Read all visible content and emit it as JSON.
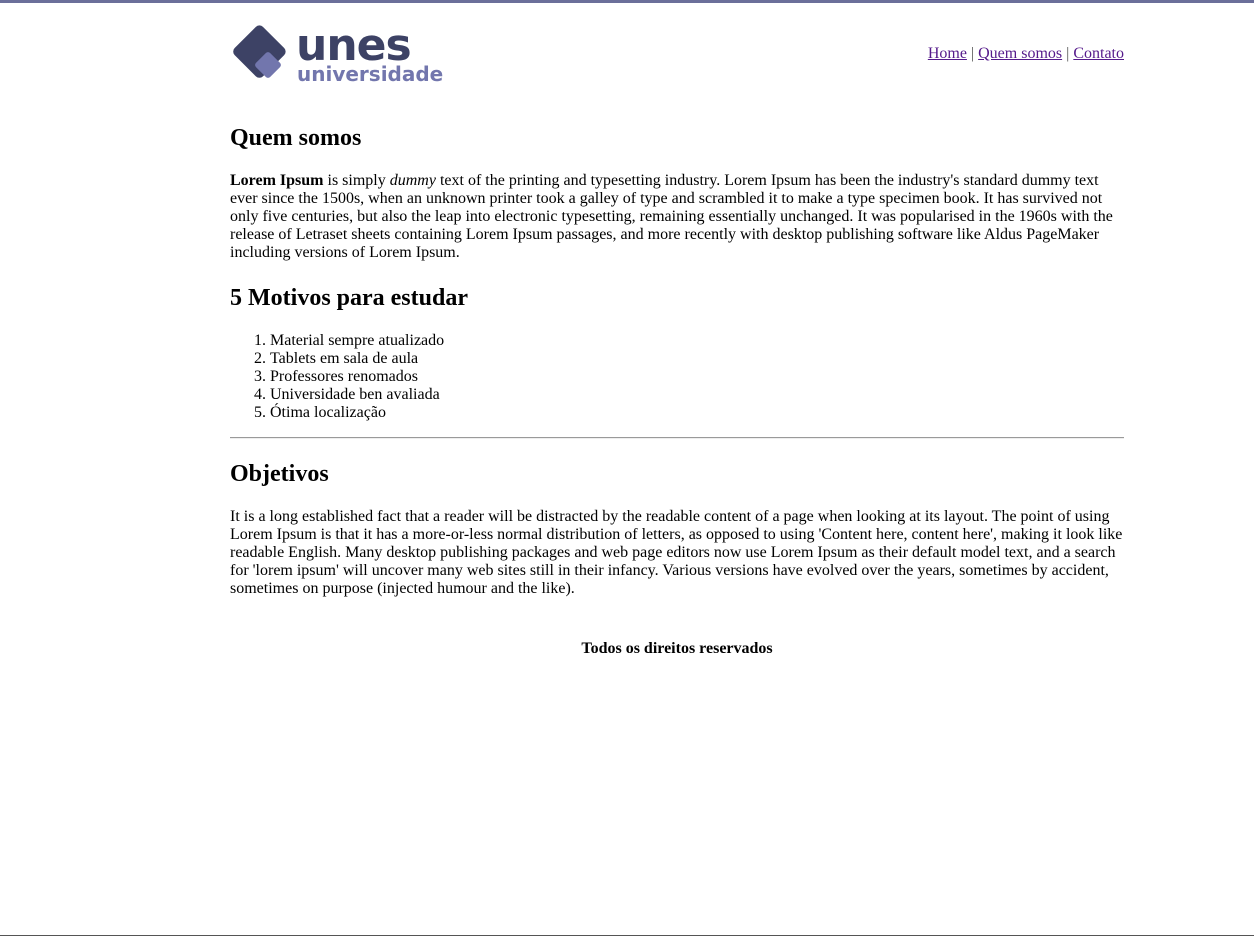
{
  "header": {
    "logo": {
      "brand": "unes",
      "subtitle": "universidade",
      "colors": {
        "dark": "#3d4265",
        "light": "#7276ad"
      }
    },
    "nav": [
      {
        "label": "Home"
      },
      {
        "label": "Quem somos"
      },
      {
        "label": "Contato"
      }
    ],
    "separator": "|"
  },
  "quem_somos": {
    "title": "Quem somos",
    "lead_bold": "Lorem Ipsum",
    "text_1": " is simply ",
    "emphasis": "dummy",
    "text_2": " text of the printing and typesetting industry. Lorem Ipsum has been the industry's standard dummy text ever since the 1500s, when an unknown printer took a galley of type and scrambled it to make a type specimen book. It has survived not only five centuries, but also the leap into electronic typesetting, remaining essentially unchanged. It was popularised in the 1960s with the release of Letraset sheets containing Lorem Ipsum passages, and more recently with desktop publishing software like Aldus PageMaker including versions of Lorem Ipsum."
  },
  "motivos": {
    "title": "5 Motivos para estudar",
    "items": [
      "Material sempre atualizado",
      "Tablets em sala de aula",
      "Professores renomados",
      "Universidade ben avaliada",
      "Ótima localização"
    ]
  },
  "objetivos": {
    "title": "Objetivos",
    "text": "It is a long established fact that a reader will be distracted by the readable content of a page when looking at its layout. The point of using Lorem Ipsum is that it has a more-or-less normal distribution of letters, as opposed to using 'Content here, content here', making it look like readable English. Many desktop publishing packages and web page editors now use Lorem Ipsum as their default model text, and a search for 'lorem ipsum' will uncover many web sites still in their infancy. Various versions have evolved over the years, sometimes by accident, sometimes on purpose (injected humour and the like)."
  },
  "footer": {
    "text": "Todos os direitos reservados"
  }
}
